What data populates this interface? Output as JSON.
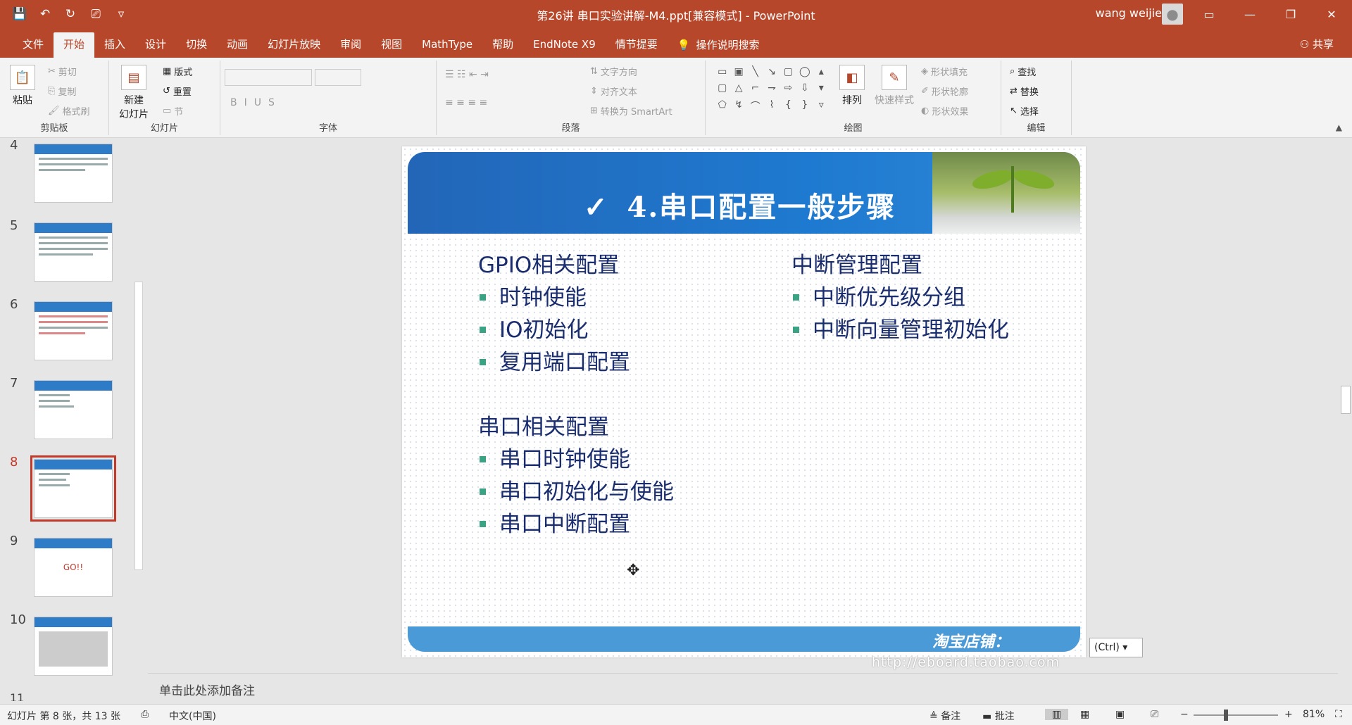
{
  "window": {
    "title": "第26讲 串口实验讲解-M4.ppt[兼容模式] - PowerPoint",
    "user": "wang weijie"
  },
  "qat": {
    "save": "💾",
    "undo": "↶",
    "redo": "↻",
    "present": "⎚",
    "more": "▿"
  },
  "tabs": [
    "文件",
    "开始",
    "插入",
    "设计",
    "切换",
    "动画",
    "幻灯片放映",
    "审阅",
    "视图",
    "MathType",
    "帮助",
    "EndNote X9",
    "情节提要"
  ],
  "tellme": "操作说明搜索",
  "share": "共享",
  "ribbon": {
    "clipboard": {
      "label": "剪贴板",
      "paste": "粘贴",
      "cut": "剪切",
      "copy": "复制",
      "painter": "格式刷"
    },
    "slides": {
      "label": "幻灯片",
      "new": "新建",
      "new2": "幻灯片",
      "layout": "版式",
      "reset": "重置",
      "section": "节"
    },
    "font": {
      "label": "字体"
    },
    "paragraph": {
      "label": "段落",
      "direction": "文字方向",
      "align": "对齐文本",
      "smartart": "转换为 SmartArt"
    },
    "drawing": {
      "label": "绘图",
      "arrange": "排列",
      "quickstyle": "快速样式",
      "fill": "形状填充",
      "outline": "形状轮廓",
      "effect": "形状效果"
    },
    "editing": {
      "label": "编辑",
      "find": "查找",
      "replace": "替换",
      "select": "选择"
    }
  },
  "thumbs": {
    "numbers": [
      "4",
      "5",
      "6",
      "7",
      "8",
      "9",
      "10",
      "11"
    ],
    "go_text": "GO!!"
  },
  "slide": {
    "title": "4.串口配置一般步骤",
    "check": "✓",
    "left": {
      "h1": "GPIO相关配置",
      "i1": [
        "时钟使能",
        "IO初始化",
        "复用端口配置"
      ],
      "h2": "串口相关配置",
      "i2": [
        "串口时钟使能",
        "串口初始化与使能",
        "串口中断配置"
      ]
    },
    "right": {
      "h1": "中断管理配置",
      "i1": [
        "中断优先级分组",
        "中断向量管理初始化"
      ]
    },
    "footer": "淘宝店铺：",
    "url": "http://eboard.taobao.com"
  },
  "paste_ctrl": "(Ctrl) ▾",
  "notes": "单击此处添加备注",
  "status": {
    "slide": "幻灯片 第 8 张，共 13 张",
    "lang": "中文(中国)",
    "notes": "备注",
    "comments": "批注",
    "zoom": "81%"
  }
}
